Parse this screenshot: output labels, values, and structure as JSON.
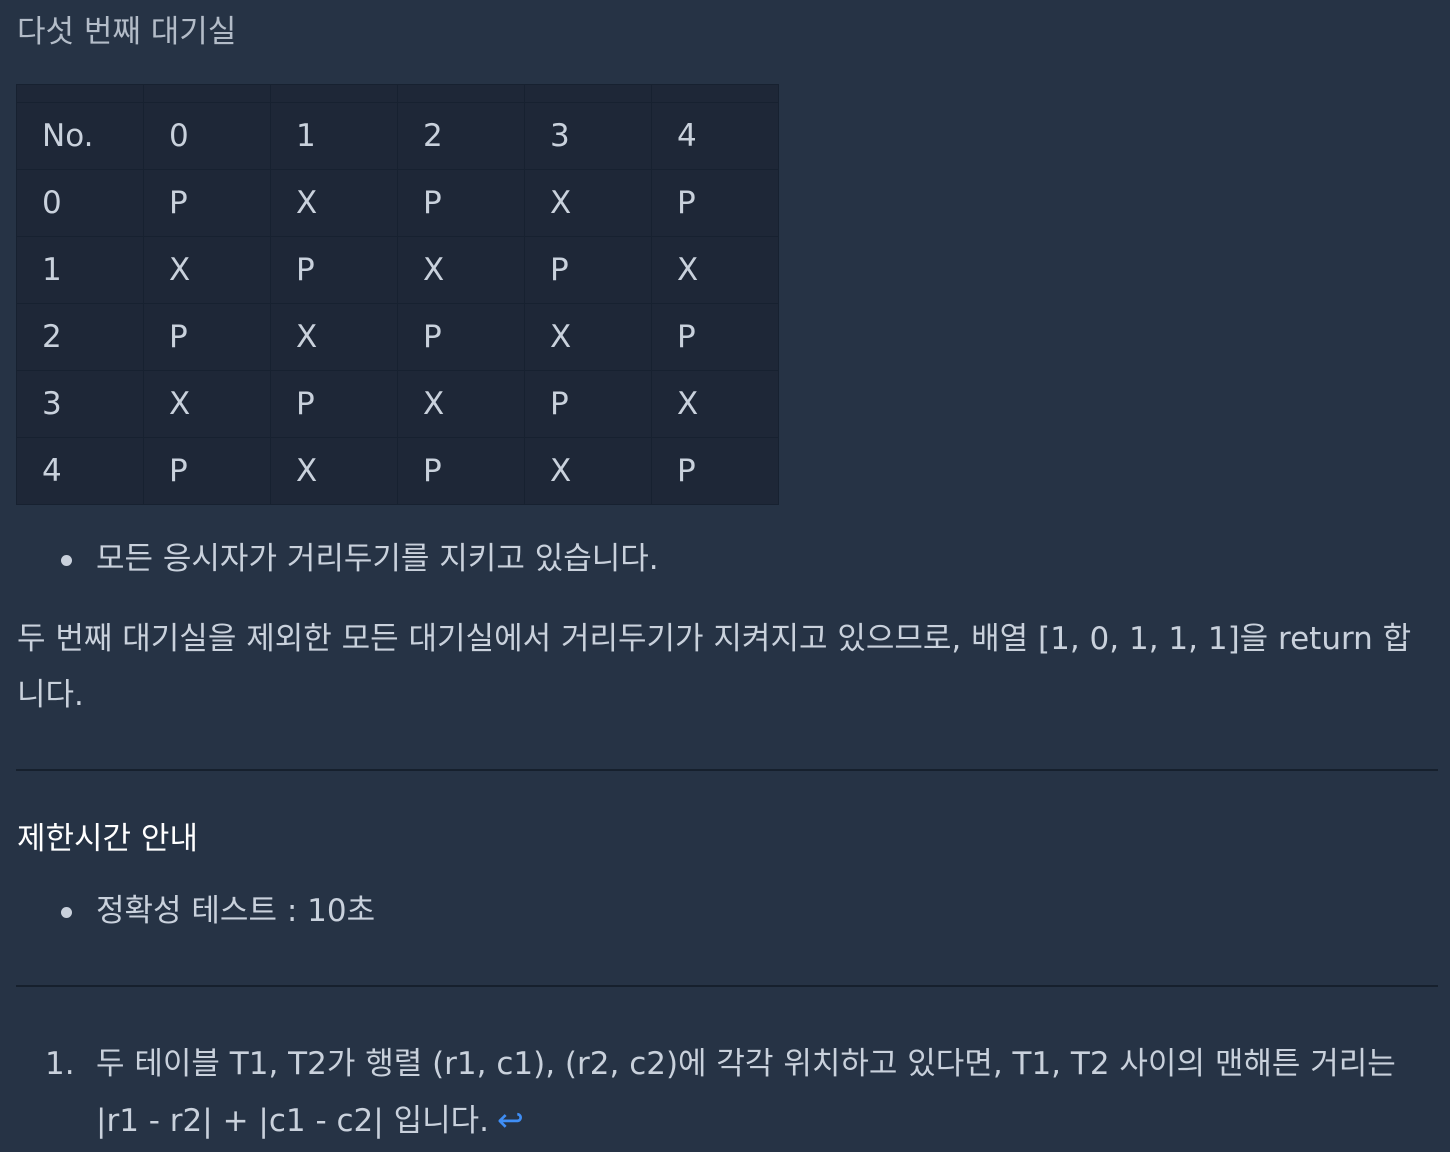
{
  "heading": "다섯 번째 대기실",
  "table": {
    "header": [
      "No.",
      "0",
      "1",
      "2",
      "3",
      "4"
    ],
    "rows": [
      [
        "0",
        "P",
        "X",
        "P",
        "X",
        "P"
      ],
      [
        "1",
        "X",
        "P",
        "X",
        "P",
        "X"
      ],
      [
        "2",
        "P",
        "X",
        "P",
        "X",
        "P"
      ],
      [
        "3",
        "X",
        "P",
        "X",
        "P",
        "X"
      ],
      [
        "4",
        "P",
        "X",
        "P",
        "X",
        "P"
      ]
    ]
  },
  "bullet_1": "모든 응시자가 거리두기를 지키고 있습니다.",
  "paragraph": "두 번째 대기실을 제외한 모든 대기실에서 거리두기가 지켜지고 있으므로, 배열 [1, 0, 1, 1, 1]을 return 합니다.",
  "time_section": {
    "title": "제한시간 안내",
    "items": [
      "정확성 테스트 : 10초"
    ]
  },
  "footnote": {
    "number": "1.",
    "text": "두 테이블 T1, T2가 행렬 (r1, c1), (r2, c2)에 각각 위치하고 있다면, T1, T2 사이의 맨해튼 거리는 |r1 - r2| + |c1 - c2| 입니다.",
    "backref_icon": "↩"
  }
}
